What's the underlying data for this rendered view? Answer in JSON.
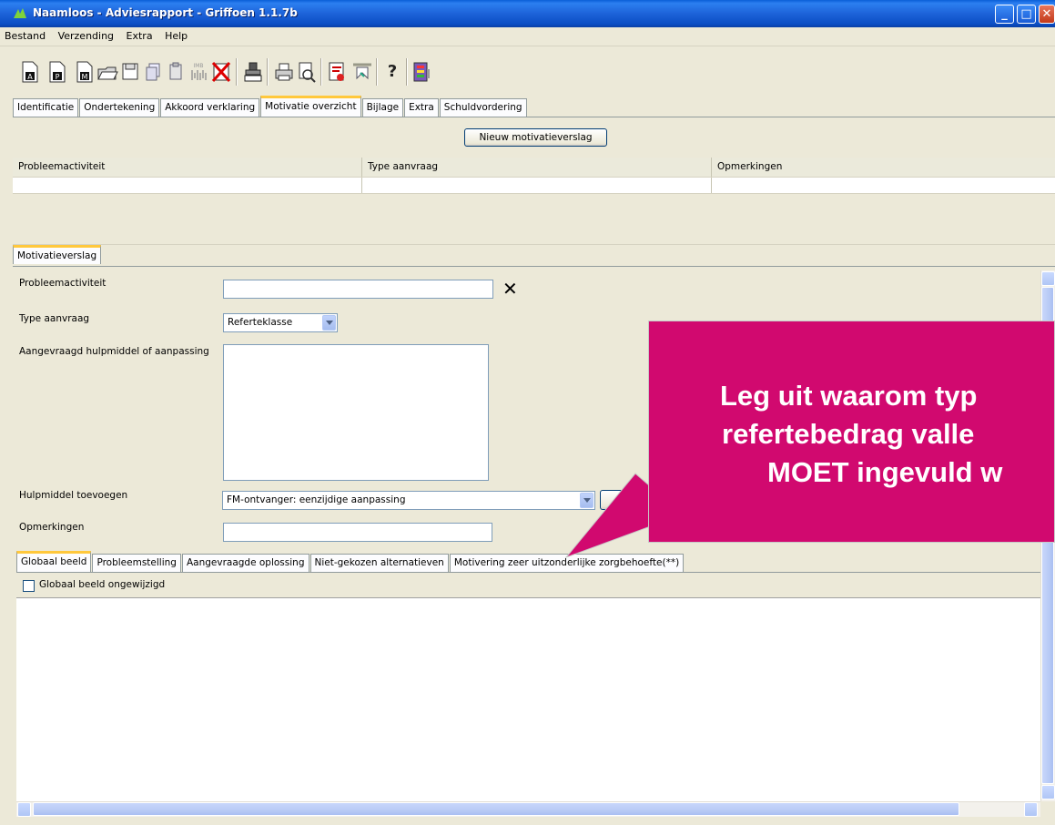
{
  "window": {
    "title": "Naamloos - Adviesrapport - Griffoen 1.1.7b",
    "controls": [
      "minimize-icon",
      "maximize-icon",
      "close-icon"
    ]
  },
  "menu": [
    "Bestand",
    "Verzending",
    "Extra",
    "Help"
  ],
  "toolbar": {
    "icons": [
      "report-a-icon",
      "report-p-icon",
      "report-m-icon",
      "open-folder-icon",
      "save-icon",
      "copy-icon",
      "paste-icon",
      "imb-icon",
      "delete-icon",
      "stamp-icon",
      "print-icon",
      "print-preview-icon",
      "pdf-export-icon",
      "send-icon",
      "help-icon",
      "exit-icon"
    ],
    "help_label": "?"
  },
  "tabs_top": [
    "Identificatie",
    "Ondertekening",
    "Akkoord verklaring",
    "Motivatie overzicht",
    "Bijlage",
    "Extra",
    "Schuldvordering"
  ],
  "active_tab_top": "Motivatie overzicht",
  "new_report_button": "Nieuw motivatieverslag",
  "grid": {
    "columns": [
      "Probleemactiviteit",
      "Type aanvraag",
      "Opmerkingen"
    ]
  },
  "section_tab": "Motivatieverslag",
  "form": {
    "probleemactiviteit_label": "Probleemactiviteit",
    "probleemactiviteit_value": "",
    "clear_glyph": "✕",
    "type_aanvraag_label": "Type aanvraag",
    "type_aanvraag_value": "Referteklasse",
    "hulpmiddel_label": "Aangevraagd hulpmiddel of aanpassing",
    "hulpmiddel_toevoegen_label": "Hulpmiddel toevoegen",
    "hulpmiddel_toevoegen_value": "FM-ontvanger: eenzijdige aanpassing",
    "opmerkingen_label": "Opmerkingen",
    "opmerkingen_value": ""
  },
  "tabs_bottom": [
    "Globaal beeld",
    "Probleemstelling",
    "Aangevraagde oplossing",
    "Niet-gekozen alternatieven",
    "Motivering zeer uitzonderlijke zorgbehoefte(**)"
  ],
  "active_tab_bottom": "Globaal beeld",
  "checkbox": {
    "label": "Globaal beeld ongewijzigd",
    "checked": false
  },
  "callout": {
    "lines": [
      "Leg uit waarom typ",
      "refertebedrag valle",
      "MOET ingevuld w"
    ],
    "color": "#d1096f"
  }
}
